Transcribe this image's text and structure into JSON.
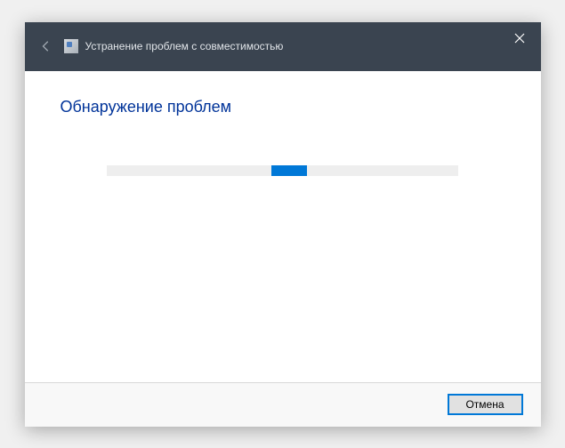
{
  "titlebar": {
    "title": "Устранение проблем с совместимостью"
  },
  "content": {
    "heading": "Обнаружение проблем"
  },
  "progress": {
    "mode": "indeterminate"
  },
  "footer": {
    "cancel_label": "Отмена"
  }
}
